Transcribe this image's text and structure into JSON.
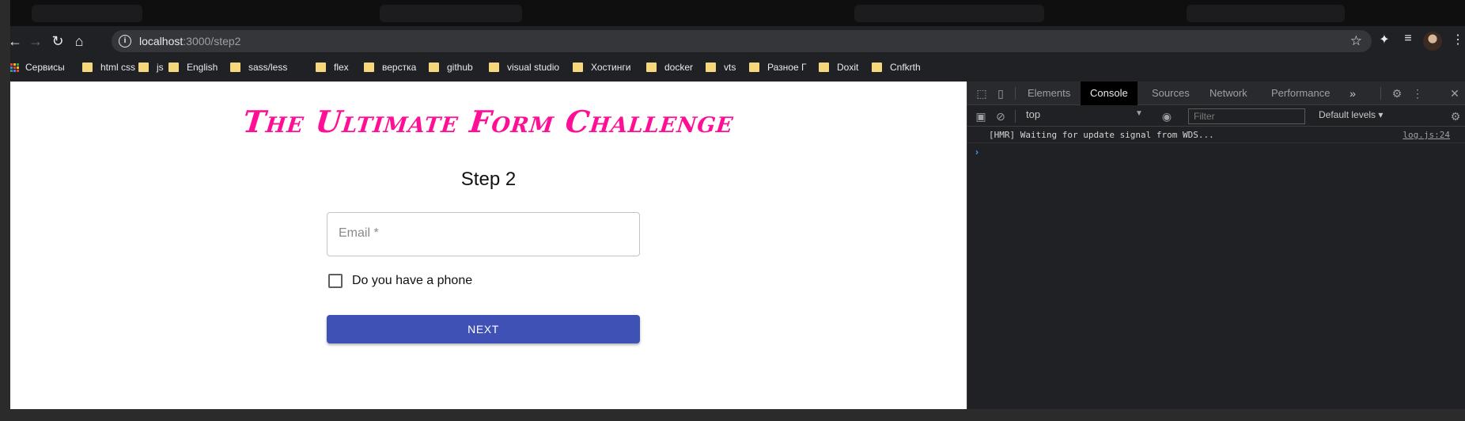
{
  "browser": {
    "url_host": "localhost",
    "url_path": ":3000/step2"
  },
  "bookmarks": [
    {
      "label": "Сервисы",
      "icon": "apps-grid-icon"
    },
    {
      "label": "html css",
      "icon": "folder-icon"
    },
    {
      "label": "js",
      "icon": "folder-icon"
    },
    {
      "label": "English",
      "icon": "folder-icon"
    },
    {
      "label": "sass/less",
      "icon": "folder-icon"
    },
    {
      "label": "flex",
      "icon": "folder-icon"
    },
    {
      "label": "верстка",
      "icon": "folder-icon"
    },
    {
      "label": "github",
      "icon": "folder-icon"
    },
    {
      "label": "visual studio",
      "icon": "folder-icon"
    },
    {
      "label": "Хостинги",
      "icon": "folder-icon"
    },
    {
      "label": "docker",
      "icon": "folder-icon"
    },
    {
      "label": "vts",
      "icon": "folder-icon"
    },
    {
      "label": "Разное Г",
      "icon": "folder-icon"
    },
    {
      "label": "Doxit",
      "icon": "folder-icon"
    },
    {
      "label": "Cnfkrth",
      "icon": "folder-icon"
    }
  ],
  "page": {
    "title": "The Ultimate Form Challenge",
    "step": "Step 2",
    "email_label": "Email *",
    "phone_checkbox_label": "Do you have a phone",
    "next_label": "NEXT"
  },
  "devtools": {
    "tabs": [
      "Elements",
      "Console",
      "Sources",
      "Network",
      "Performance"
    ],
    "active_tab": "Console",
    "context": "top",
    "filter_placeholder": "Filter",
    "levels": "Default levels",
    "log": {
      "message": "[HMR] Waiting for update signal from WDS...",
      "source": "log.js:24"
    }
  },
  "colors": {
    "title_pink": "#ff0f95",
    "button_indigo": "#3f51b5",
    "folder_yellow": "#f6d77b"
  }
}
